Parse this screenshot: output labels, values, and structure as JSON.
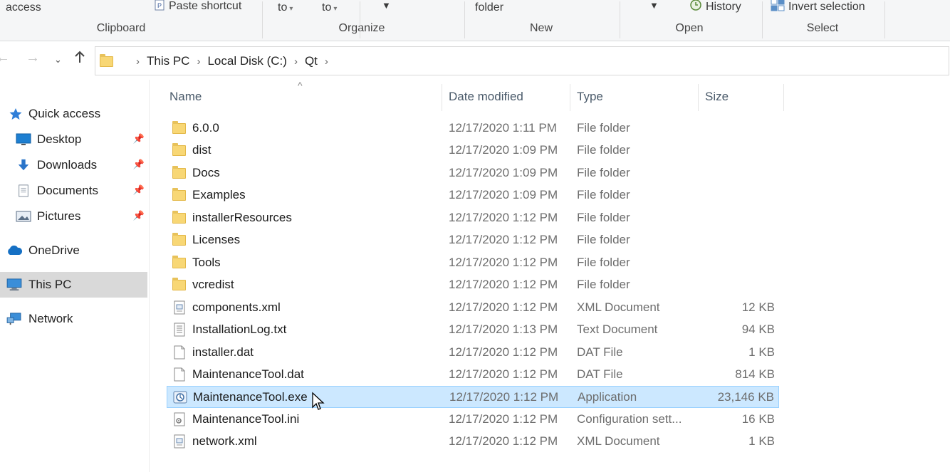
{
  "ribbon": {
    "access_label": "access",
    "paste_shortcut_label": "Paste shortcut",
    "move_to_label": "to",
    "copy_to_label": "to",
    "new_folder_label": "folder",
    "history_label": "History",
    "invert_selection_label": "Invert selection",
    "groups": {
      "clipboard": "Clipboard",
      "organize": "Organize",
      "new": "New",
      "open": "Open",
      "select": "Select"
    }
  },
  "address": {
    "breadcrumbs": [
      "This PC",
      "Local Disk (C:)",
      "Qt"
    ]
  },
  "sidebar": {
    "items": [
      {
        "label": "Quick access",
        "icon": "star-icon"
      },
      {
        "label": "Desktop",
        "icon": "desktop-icon",
        "pinned": true
      },
      {
        "label": "Downloads",
        "icon": "download-icon",
        "pinned": true
      },
      {
        "label": "Documents",
        "icon": "documents-icon",
        "pinned": true
      },
      {
        "label": "Pictures",
        "icon": "pictures-icon",
        "pinned": true
      },
      {
        "label": "OneDrive",
        "icon": "cloud-icon"
      },
      {
        "label": "This PC",
        "icon": "computer-icon",
        "selected": true
      },
      {
        "label": "Network",
        "icon": "network-icon"
      }
    ]
  },
  "columns": {
    "name": "Name",
    "date": "Date modified",
    "type": "Type",
    "size": "Size"
  },
  "files": [
    {
      "name": "6.0.0",
      "date": "12/17/2020 1:11 PM",
      "type": "File folder",
      "size": "",
      "icon": "folder-icon"
    },
    {
      "name": "dist",
      "date": "12/17/2020 1:09 PM",
      "type": "File folder",
      "size": "",
      "icon": "folder-icon"
    },
    {
      "name": "Docs",
      "date": "12/17/2020 1:09 PM",
      "type": "File folder",
      "size": "",
      "icon": "folder-icon"
    },
    {
      "name": "Examples",
      "date": "12/17/2020 1:09 PM",
      "type": "File folder",
      "size": "",
      "icon": "folder-icon"
    },
    {
      "name": "installerResources",
      "date": "12/17/2020 1:12 PM",
      "type": "File folder",
      "size": "",
      "icon": "folder-icon"
    },
    {
      "name": "Licenses",
      "date": "12/17/2020 1:12 PM",
      "type": "File folder",
      "size": "",
      "icon": "folder-icon"
    },
    {
      "name": "Tools",
      "date": "12/17/2020 1:12 PM",
      "type": "File folder",
      "size": "",
      "icon": "folder-icon"
    },
    {
      "name": "vcredist",
      "date": "12/17/2020 1:12 PM",
      "type": "File folder",
      "size": "",
      "icon": "folder-icon"
    },
    {
      "name": "components.xml",
      "date": "12/17/2020 1:12 PM",
      "type": "XML Document",
      "size": "12 KB",
      "icon": "xml-file-icon"
    },
    {
      "name": "InstallationLog.txt",
      "date": "12/17/2020 1:13 PM",
      "type": "Text Document",
      "size": "94 KB",
      "icon": "text-file-icon"
    },
    {
      "name": "installer.dat",
      "date": "12/17/2020 1:12 PM",
      "type": "DAT File",
      "size": "1 KB",
      "icon": "file-icon"
    },
    {
      "name": "MaintenanceTool.dat",
      "date": "12/17/2020 1:12 PM",
      "type": "DAT File",
      "size": "814 KB",
      "icon": "file-icon"
    },
    {
      "name": "MaintenanceTool.exe",
      "date": "12/17/2020 1:12 PM",
      "type": "Application",
      "size": "23,146 KB",
      "icon": "application-icon",
      "selected": true
    },
    {
      "name": "MaintenanceTool.ini",
      "date": "12/17/2020 1:12 PM",
      "type": "Configuration sett...",
      "size": "16 KB",
      "icon": "config-file-icon"
    },
    {
      "name": "network.xml",
      "date": "12/17/2020 1:12 PM",
      "type": "XML Document",
      "size": "1 KB",
      "icon": "xml-file-icon"
    }
  ],
  "colors": {
    "selection_bg": "#cce8ff",
    "selection_border": "#99d1ff",
    "folder": "#f8d775",
    "sidebar_selected": "#d9d9d9"
  }
}
